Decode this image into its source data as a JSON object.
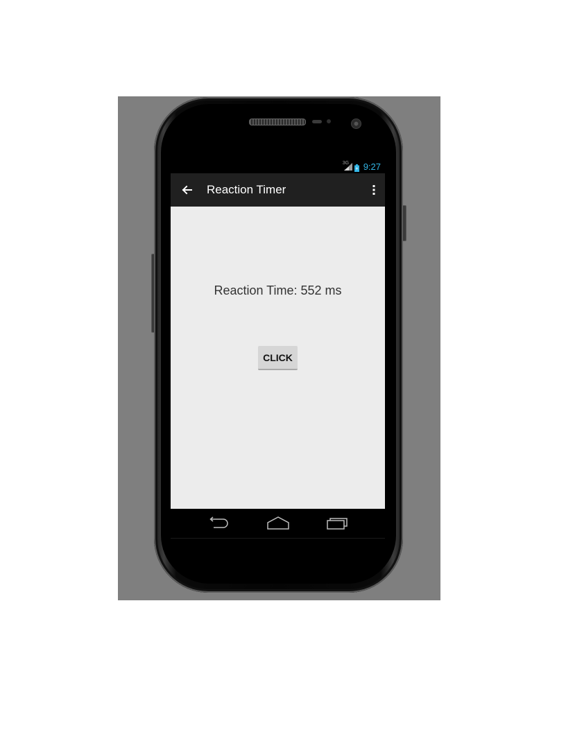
{
  "status_bar": {
    "network_label": "3G",
    "time": "9:27",
    "time_color": "#33b5e5"
  },
  "action_bar": {
    "title": "Reaction Timer",
    "back_icon": "arrow-left-icon",
    "menu_icon": "overflow-menu-icon"
  },
  "main": {
    "reaction_text": "Reaction Time: 552 ms",
    "button_label": "CLICK"
  },
  "nav_bar": {
    "back_icon": "nav-back-icon",
    "home_icon": "nav-home-icon",
    "recents_icon": "nav-recents-icon"
  },
  "colors": {
    "backdrop": "#7f7f7f",
    "action_bar": "#202020",
    "content_bg": "#ececec",
    "button_bg": "#d6d6d6"
  }
}
